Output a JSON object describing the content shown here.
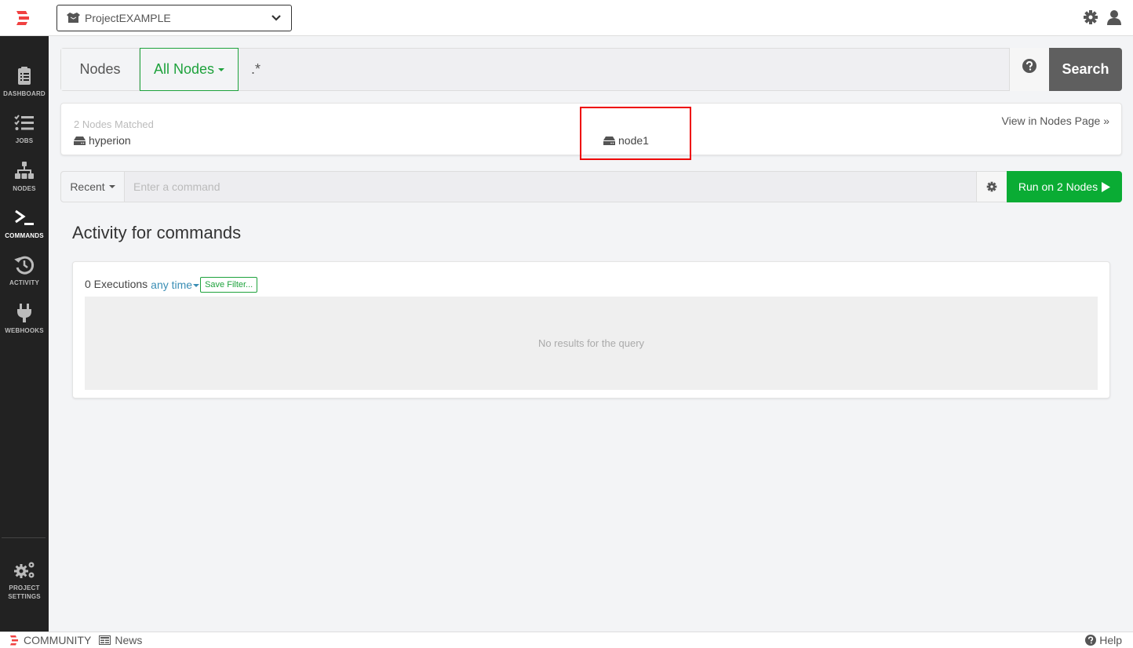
{
  "header": {
    "project_name": "ProjectEXAMPLE",
    "brand_color": "#f04141"
  },
  "sidebar": {
    "items": [
      {
        "id": "dashboard",
        "label": "DASHBOARD",
        "icon": "clipboard-icon",
        "active": false
      },
      {
        "id": "jobs",
        "label": "JOBS",
        "icon": "task-list-icon",
        "active": false
      },
      {
        "id": "nodes",
        "label": "NODES",
        "icon": "sitemap-icon",
        "active": false
      },
      {
        "id": "commands",
        "label": "COMMANDS",
        "icon": "terminal-icon",
        "active": true
      },
      {
        "id": "activity",
        "label": "ACTIVITY",
        "icon": "history-icon",
        "active": false
      },
      {
        "id": "webhooks",
        "label": "WEBHOOKS",
        "icon": "plug-icon",
        "active": false
      }
    ],
    "project_settings": {
      "line1": "PROJECT",
      "line2": "SETTINGS"
    }
  },
  "node_filter": {
    "label": "Nodes",
    "dropdown_label": "All Nodes",
    "filter_value": ".*",
    "search_label": "Search"
  },
  "matched": {
    "count_text": "2 Nodes Matched",
    "nodes": [
      "hyperion",
      "node1"
    ],
    "view_link": "View in Nodes Page »"
  },
  "command": {
    "recent_label": "Recent",
    "placeholder": "Enter a command",
    "value": "",
    "run_label": "Run on 2 Nodes"
  },
  "activity": {
    "title": "Activity for commands",
    "executions": "0 Executions",
    "time_filter": "any time",
    "save_filter": "Save Filter...",
    "empty_text": "No results for the query"
  },
  "footer": {
    "community": "COMMUNITY",
    "news": "News",
    "help": "Help"
  },
  "colors": {
    "accent_green": "#1ea23c",
    "run_button": "#0aac34",
    "search_button": "#5f5f5f",
    "sidebar_bg": "#222222",
    "link_blue": "#3a8eb5",
    "highlight_red": "#ee0000"
  }
}
